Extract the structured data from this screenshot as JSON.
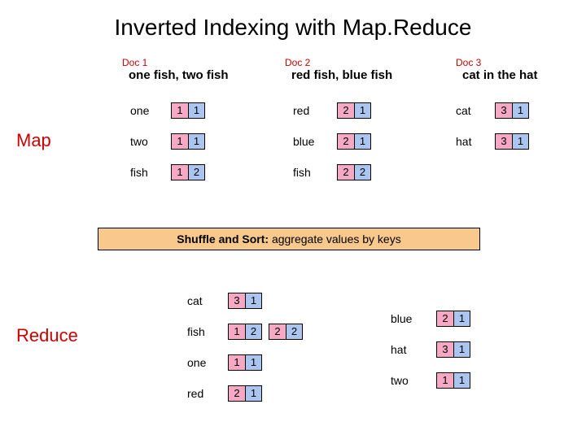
{
  "title": "Inverted Indexing with Map.Reduce",
  "stage_map": "Map",
  "stage_reduce": "Reduce",
  "shuffle": {
    "bold": "Shuffle and Sort:",
    "rest": " aggregate values by keys"
  },
  "docs": [
    {
      "label": "Doc 1",
      "text": "one fish, two fish"
    },
    {
      "label": "Doc 2",
      "text": "red fish, blue fish"
    },
    {
      "label": "Doc 3",
      "text": "cat in the hat"
    }
  ],
  "map": [
    {
      "col": 0,
      "rows": [
        {
          "w": "one",
          "a": "1",
          "b": "1"
        },
        {
          "w": "two",
          "a": "1",
          "b": "1"
        },
        {
          "w": "fish",
          "a": "1",
          "b": "2"
        }
      ]
    },
    {
      "col": 1,
      "rows": [
        {
          "w": "red",
          "a": "2",
          "b": "1"
        },
        {
          "w": "blue",
          "a": "2",
          "b": "1"
        },
        {
          "w": "fish",
          "a": "2",
          "b": "2"
        }
      ]
    },
    {
      "col": 2,
      "rows": [
        {
          "w": "cat",
          "a": "3",
          "b": "1"
        },
        {
          "w": "hat",
          "a": "3",
          "b": "1"
        }
      ]
    }
  ],
  "reduce_left": [
    {
      "w": "cat",
      "pairs": [
        [
          "3",
          "1"
        ]
      ]
    },
    {
      "w": "fish",
      "pairs": [
        [
          "1",
          "2"
        ],
        [
          "2",
          "2"
        ]
      ]
    },
    {
      "w": "one",
      "pairs": [
        [
          "1",
          "1"
        ]
      ]
    },
    {
      "w": "red",
      "pairs": [
        [
          "2",
          "1"
        ]
      ]
    }
  ],
  "reduce_right": [
    {
      "w": "blue",
      "pairs": [
        [
          "2",
          "1"
        ]
      ]
    },
    {
      "w": "hat",
      "pairs": [
        [
          "3",
          "1"
        ]
      ]
    },
    {
      "w": "two",
      "pairs": [
        [
          "1",
          "1"
        ]
      ]
    }
  ]
}
